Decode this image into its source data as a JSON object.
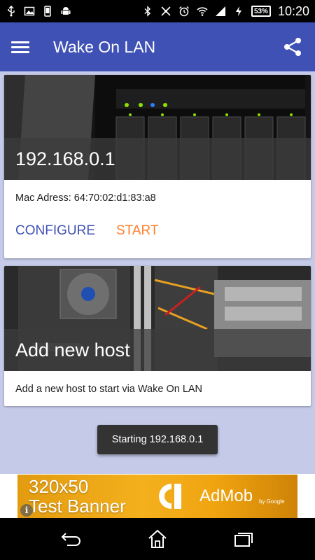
{
  "status_bar": {
    "battery": "53%",
    "time": "10:20",
    "icons_left": [
      "usb-icon",
      "image-icon",
      "phone-icon",
      "android-icon"
    ],
    "icons_right": [
      "bluetooth-icon",
      "nfc-icon",
      "alarm-icon",
      "wifi-icon",
      "signal-icon",
      "charging-icon"
    ]
  },
  "app_bar": {
    "title": "Wake On LAN",
    "menu_icon": "hamburger-icon",
    "share_icon": "share-icon",
    "color": "#3f51b5"
  },
  "hosts": [
    {
      "title": "192.168.0.1",
      "subtitle": "Mac Adress: 64:70:02:d1:83:a8",
      "actions": {
        "configure": "CONFIGURE",
        "start": "START"
      }
    }
  ],
  "add_host": {
    "title": "Add new host",
    "subtitle": "Add a new host to start via Wake On LAN"
  },
  "toast": "Starting 192.168.0.1",
  "ad": {
    "line1": "320x50",
    "line2": "Test Banner",
    "brand": "AdMob",
    "by": "by Google"
  },
  "nav_bar": [
    "back-icon",
    "home-icon",
    "recents-icon"
  ],
  "colors": {
    "primary": "#3f51b5",
    "accent": "#ff7f2a",
    "background": "#c5cae9"
  }
}
